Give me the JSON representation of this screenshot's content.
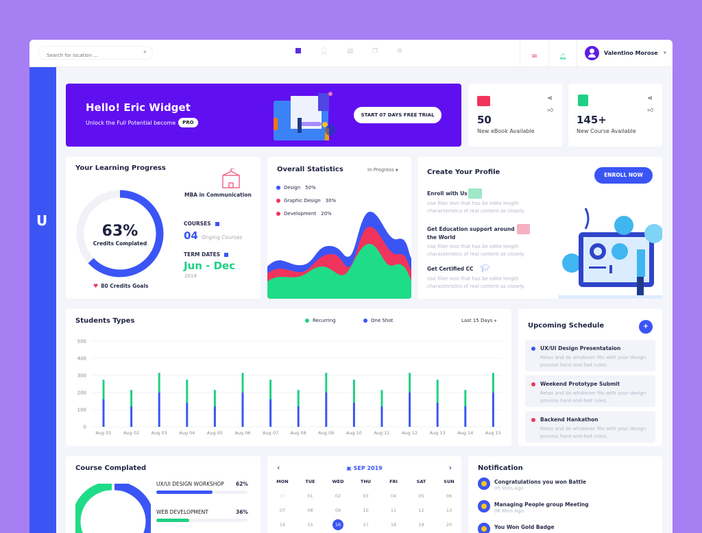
{
  "topbar": {
    "search_placeholder": "Search for location ...",
    "nav_icons": [
      "dashboard-icon",
      "user-icon",
      "document-icon",
      "copy-icon",
      "gear-icon"
    ],
    "user_name": "Valentino Morose"
  },
  "sidebar": {
    "logo": "U"
  },
  "banner": {
    "title": "Hello! Eric Widget",
    "subtitle": "Unlock the Full Potential become",
    "badge": "PRO",
    "cta": "START 07 DAYS FREE TRIAL"
  },
  "stats_cards": [
    {
      "value": "50",
      "label": "New eBook Available",
      "color": "#f0345c"
    },
    {
      "value": "145+",
      "label": "New Course Available",
      "color": "#1fd084"
    }
  ],
  "learning": {
    "title": "Your Learning Progress",
    "percent": "63%",
    "percent_value": 63,
    "caption": "Credits Complated",
    "goal": "80 Credits Goals",
    "program": "MBA in Communication",
    "courses_label": "COURSES",
    "courses_count": "04",
    "courses_text": "Onging Courses",
    "term_label": "TERM DATES",
    "term_value": "Jun - Dec",
    "term_year": "2019"
  },
  "overall": {
    "title": "Overall Statistics",
    "filter": "In Progress",
    "legend": [
      {
        "label": "Design",
        "pct": "50%",
        "color": "#3b55f5"
      },
      {
        "label": "Graphic Design",
        "pct": "30%",
        "color": "#f0345c"
      },
      {
        "label": "Development",
        "pct": "20%",
        "color": "#f0345c"
      }
    ]
  },
  "profile": {
    "title": "Create Your Profile",
    "button": "ENROLL NOW",
    "items": [
      {
        "title": "Enroll with Us",
        "desc": "Use filler text that has be edite length characteristics of real content as closely."
      },
      {
        "title": "Get Education support around the World",
        "desc": "Use filler text that has be edite length characteristics of real content as closely."
      },
      {
        "title": "Get Certified CC",
        "desc": "Use filler text that has be edite length characteristics of real content as closely."
      }
    ]
  },
  "students": {
    "title": "Students Types",
    "filter": "Last 15 Days"
  },
  "chart_data": {
    "type": "bar",
    "stacked": true,
    "categories": [
      "Aug 01",
      "Aug 02",
      "Aug 03",
      "Aug 04",
      "Aug 05",
      "Aug 06",
      "Aug 07",
      "Aug 08",
      "Aug 09",
      "Aug 10",
      "Aug 11",
      "Aug 12",
      "Aug 13",
      "Aug 14",
      "Aug 15"
    ],
    "series": [
      {
        "name": "One Shot",
        "color": "#3b55f5",
        "values": [
          160,
          120,
          200,
          140,
          120,
          200,
          160,
          120,
          200,
          140,
          120,
          200,
          140,
          120,
          200
        ]
      },
      {
        "name": "Recurring",
        "color": "#1fd084",
        "values": [
          115,
          95,
          115,
          135,
          95,
          115,
          115,
          95,
          115,
          135,
          95,
          115,
          135,
          95,
          115
        ]
      }
    ],
    "yticks": [
      0,
      100,
      200,
      300,
      400,
      500
    ],
    "ylim": [
      0,
      500
    ],
    "grid": true,
    "legend": "top"
  },
  "schedule": {
    "title": "Upcoming Schedule",
    "add": "+",
    "items": [
      {
        "title": "UX/UI Design Presentataion",
        "desc": "Relax and do whatever fits with your design process hard-and-fast rules.",
        "color": "#3b55f5"
      },
      {
        "title": "Weekend Prototype Submit",
        "desc": "Relax and do whatever fits with your design process hard-and-fast rules.",
        "color": "#f0345c"
      },
      {
        "title": "Backend Hankathon",
        "desc": "Relax and do whatever fits with your design process hard-and-fast rules.",
        "color": "#f0345c"
      }
    ]
  },
  "course_completed": {
    "title": "Course Complated",
    "items": [
      {
        "label": "UX/UI DESIGN WORKSHOP",
        "pct": "62%",
        "value": 62,
        "color": "#3b55f5"
      },
      {
        "label": "WEB DEVELOPMENT",
        "pct": "36%",
        "value": 36,
        "color": "#1fd084"
      }
    ]
  },
  "calendar": {
    "month": "SEP 2019",
    "prev": "‹",
    "next": "›",
    "days": [
      "MON",
      "TUE",
      "WED",
      "THU",
      "FRI",
      "SAT",
      "SUN"
    ],
    "weeks": [
      [
        "30",
        "01",
        "02",
        "03",
        "04",
        "05",
        "06"
      ],
      [
        "07",
        "08",
        "09",
        "10",
        "11",
        "12",
        "13"
      ],
      [
        "14",
        "15",
        "16",
        "17",
        "18",
        "19",
        "20"
      ]
    ],
    "selected": "16"
  },
  "notifications": {
    "title": "Notification",
    "items": [
      {
        "title": "Congratulations you won Battle",
        "time": "05 Mins Ago"
      },
      {
        "title": "Managing People group Meeting",
        "time": "06 Mins Ago"
      },
      {
        "title": "You Won Gold Badge",
        "time": ""
      }
    ]
  }
}
